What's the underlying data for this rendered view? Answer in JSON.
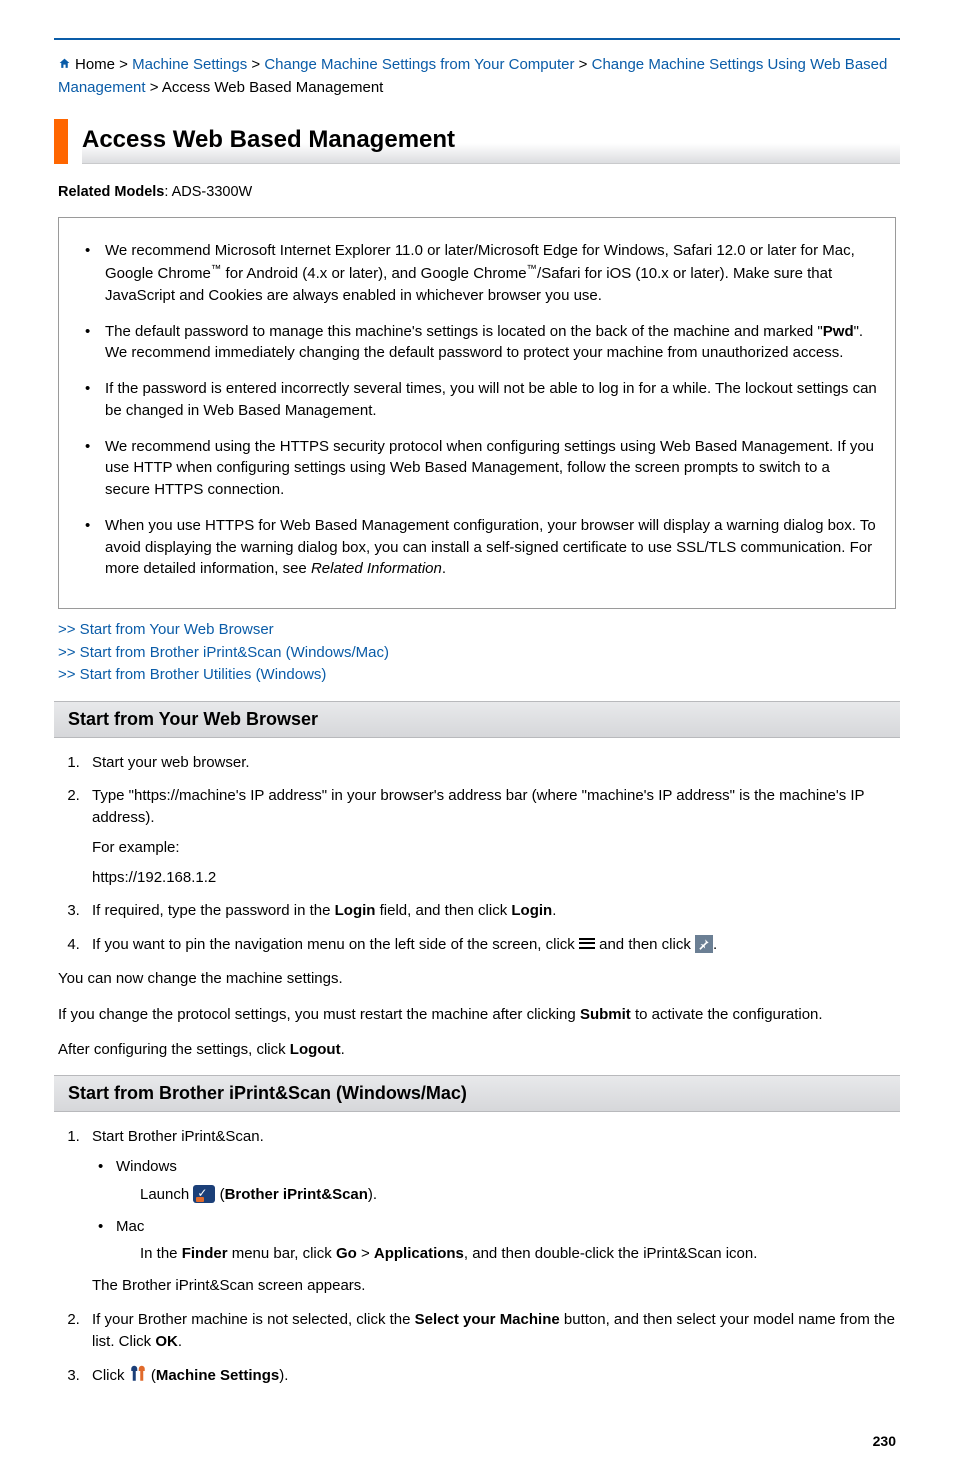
{
  "breadcrumb": {
    "home": "Home",
    "sep": " > ",
    "link1": "Machine Settings",
    "link2": "Change Machine Settings from Your Computer",
    "link3": "Change Machine Settings Using Web Based Management",
    "current": "Access Web Based Management"
  },
  "title": "Access Web Based Management",
  "related_models_label": "Related Models",
  "related_models_value": ": ADS-3300W",
  "notes": {
    "n1a": "We recommend Microsoft Internet Explorer 11.0 or later/Microsoft Edge for Windows, Safari 12.0 or later for Mac, Google Chrome",
    "n1b": " for Android (4.x or later), and Google Chrome",
    "n1c": "/Safari for iOS (10.x or later). Make sure that JavaScript and Cookies are always enabled in whichever browser you use.",
    "tm": "™",
    "n2a": "The default password to manage this machine's settings is located on the back of the machine and marked \"",
    "n2b": "Pwd",
    "n2c": "\". We recommend immediately changing the default password to protect your machine from unauthorized access.",
    "n3": "If the password is entered incorrectly several times, you will not be able to log in for a while. The lockout settings can be changed in Web Based Management.",
    "n4": "We recommend using the HTTPS security protocol when configuring settings using Web Based Management. If you use HTTP when configuring settings using Web Based Management, follow the screen prompts to switch to a secure HTTPS connection.",
    "n5a": "When you use HTTPS for Web Based Management configuration, your browser will display a warning dialog box. To avoid displaying the warning dialog box, you can install a self-signed certificate to use SSL/TLS communication. For more detailed information, see ",
    "n5b": "Related Information",
    "n5c": "."
  },
  "links": {
    "l1": ">> Start from Your Web Browser",
    "l2": ">> Start from Brother iPrint&Scan (Windows/Mac)",
    "l3": ">> Start from Brother Utilities (Windows)"
  },
  "section1": {
    "heading": "Start from Your Web Browser",
    "s1": "Start your web browser.",
    "s2": "Type \"https://machine's IP address\" in your browser's address bar (where \"machine's IP address\" is the machine's IP address).",
    "s2_ex_label": "For example:",
    "s2_ex": "https://192.168.1.2",
    "s3a": "If required, type the password in the ",
    "s3b": "Login",
    "s3c": " field, and then click ",
    "s3d": "Login",
    "s3e": ".",
    "s4a": "If you want to pin the navigation menu on the left side of the screen, click ",
    "s4b": " and then click ",
    "s4c": ".",
    "after1": "You can now change the machine settings.",
    "after2a": "If you change the protocol settings, you must restart the machine after clicking ",
    "after2b": "Submit",
    "after2c": " to activate the configuration.",
    "after3a": "After configuring the settings, click ",
    "after3b": "Logout",
    "after3c": "."
  },
  "section2": {
    "heading": "Start from Brother iPrint&Scan (Windows/Mac)",
    "s1": "Start Brother iPrint&Scan.",
    "win_label": "Windows",
    "win_a": "Launch ",
    "win_b": " (",
    "win_c": "Brother iPrint&Scan",
    "win_d": ").",
    "mac_label": "Mac",
    "mac_a": "In the ",
    "mac_b": "Finder",
    "mac_c": " menu bar, click ",
    "mac_d": "Go",
    "mac_e": " > ",
    "mac_f": "Applications",
    "mac_g": ", and then double-click the iPrint&Scan icon.",
    "s1_after": "The Brother iPrint&Scan screen appears.",
    "s2a": "If your Brother machine is not selected, click the ",
    "s2b": "Select your Machine",
    "s2c": " button, and then select your model name from the list. Click ",
    "s2d": "OK",
    "s2e": ".",
    "s3a": "Click ",
    "s3b": " (",
    "s3c": "Machine Settings",
    "s3d": ")."
  },
  "page_number": "230"
}
